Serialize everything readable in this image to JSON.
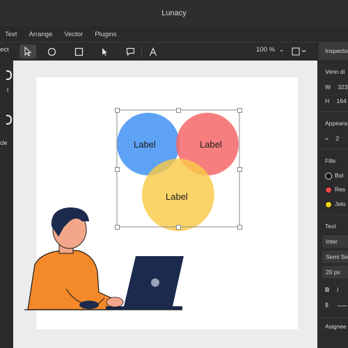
{
  "app": {
    "title": "Lunacy"
  },
  "menu": [
    "Text",
    "Arrange",
    "Vector",
    "Plugins"
  ],
  "toolbar": {
    "left_cut": "ect",
    "zoom": "100 %",
    "zoom_chevron": "⌄"
  },
  "left_panel": {
    "item1": "t",
    "item2": "cle"
  },
  "inspector": {
    "header": "Inspector",
    "layer_name": "Venn di",
    "w_label": "W",
    "w_value": "323",
    "h_label": "H",
    "h_value": "164",
    "appearance": "Appeara",
    "opacity_value": "2",
    "fills_title": "Fills",
    "fills": [
      {
        "name": "Bol",
        "color": "#111111"
      },
      {
        "name": "Res",
        "color": "#f04a4a"
      },
      {
        "name": "Jelo",
        "color": "#f2d21b"
      }
    ],
    "text_title": "Text",
    "font_family": "Inter",
    "font_weight": "Semi Se",
    "font_size": "20 px",
    "bold": "B",
    "italic": "I",
    "currency": "$",
    "assigned": "Asignee"
  },
  "venn": {
    "labels": [
      "Label",
      "Label",
      "Label"
    ],
    "colors": {
      "blue": "#3d8ff3",
      "red": "#f45b5b",
      "yellow": "#f8c538"
    }
  }
}
